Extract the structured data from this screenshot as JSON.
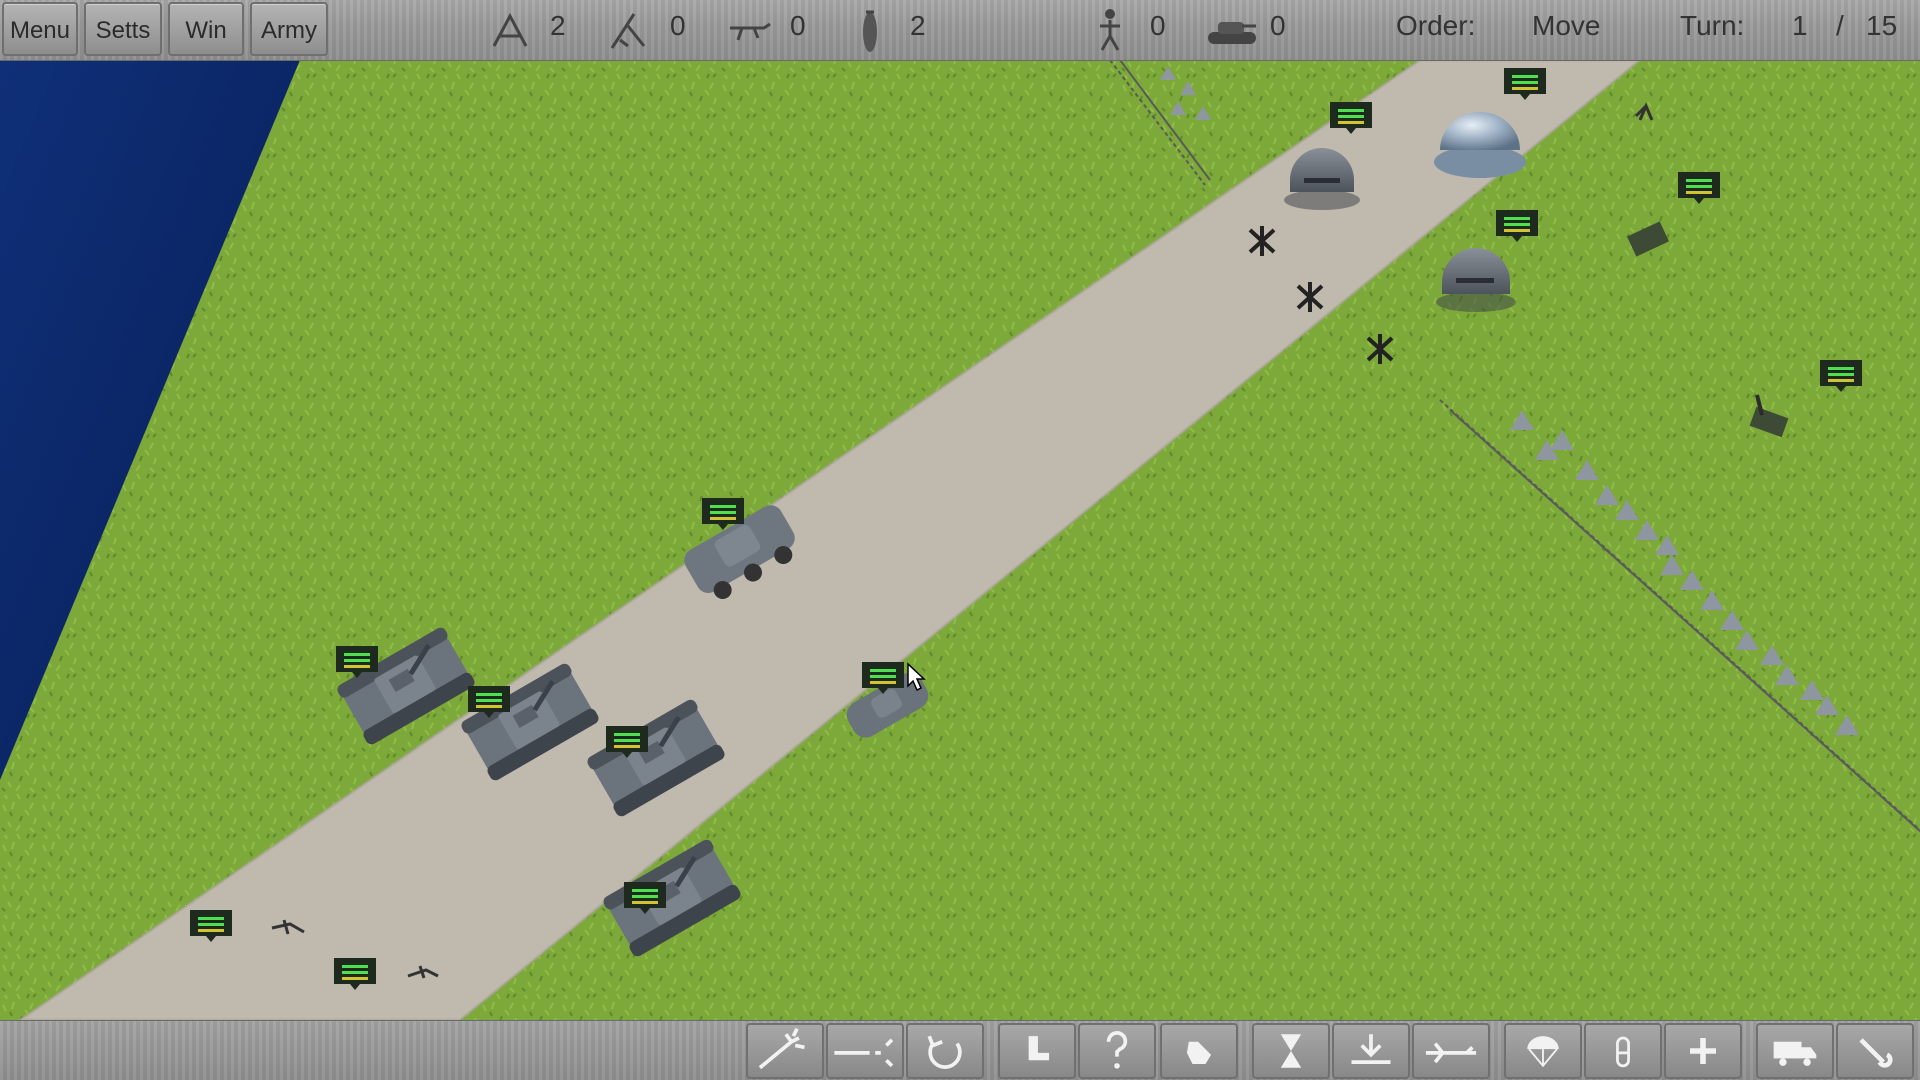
{
  "topbar": {
    "menu_label": "Menu",
    "setts_label": "Setts",
    "win_label": "Win",
    "army_label": "Army",
    "counters": [
      {
        "icon": "mortar-icon",
        "value": "2"
      },
      {
        "icon": "artillery-icon",
        "value": "0"
      },
      {
        "icon": "machine-gun-icon",
        "value": "0"
      },
      {
        "icon": "bomb-icon",
        "value": "2"
      },
      {
        "icon": "soldier-icon",
        "value": "0"
      },
      {
        "icon": "tank-icon",
        "value": "0"
      }
    ],
    "order_label": "Order:",
    "order_value": "Move",
    "turn_label": "Turn:",
    "turn_current": "1",
    "turn_sep": "/",
    "turn_total": "15"
  },
  "bottombar": {
    "tools": [
      "flare-icon",
      "rifle-aim-icon",
      "rotate-icon",
      "boot-icon",
      "help-icon",
      "hand-icon",
      "hourglass-icon",
      "landing-icon",
      "airplane-icon",
      "parachute-icon",
      "ammo-icon",
      "medic-plus-icon",
      "truck-icon",
      "wrench-icon"
    ]
  },
  "colors": {
    "grass": "#7faa3a",
    "road": "#bdb7ac",
    "water": "#0d2a6b",
    "unit_gray": "#6f7782",
    "marker_green": "#47c24a"
  }
}
